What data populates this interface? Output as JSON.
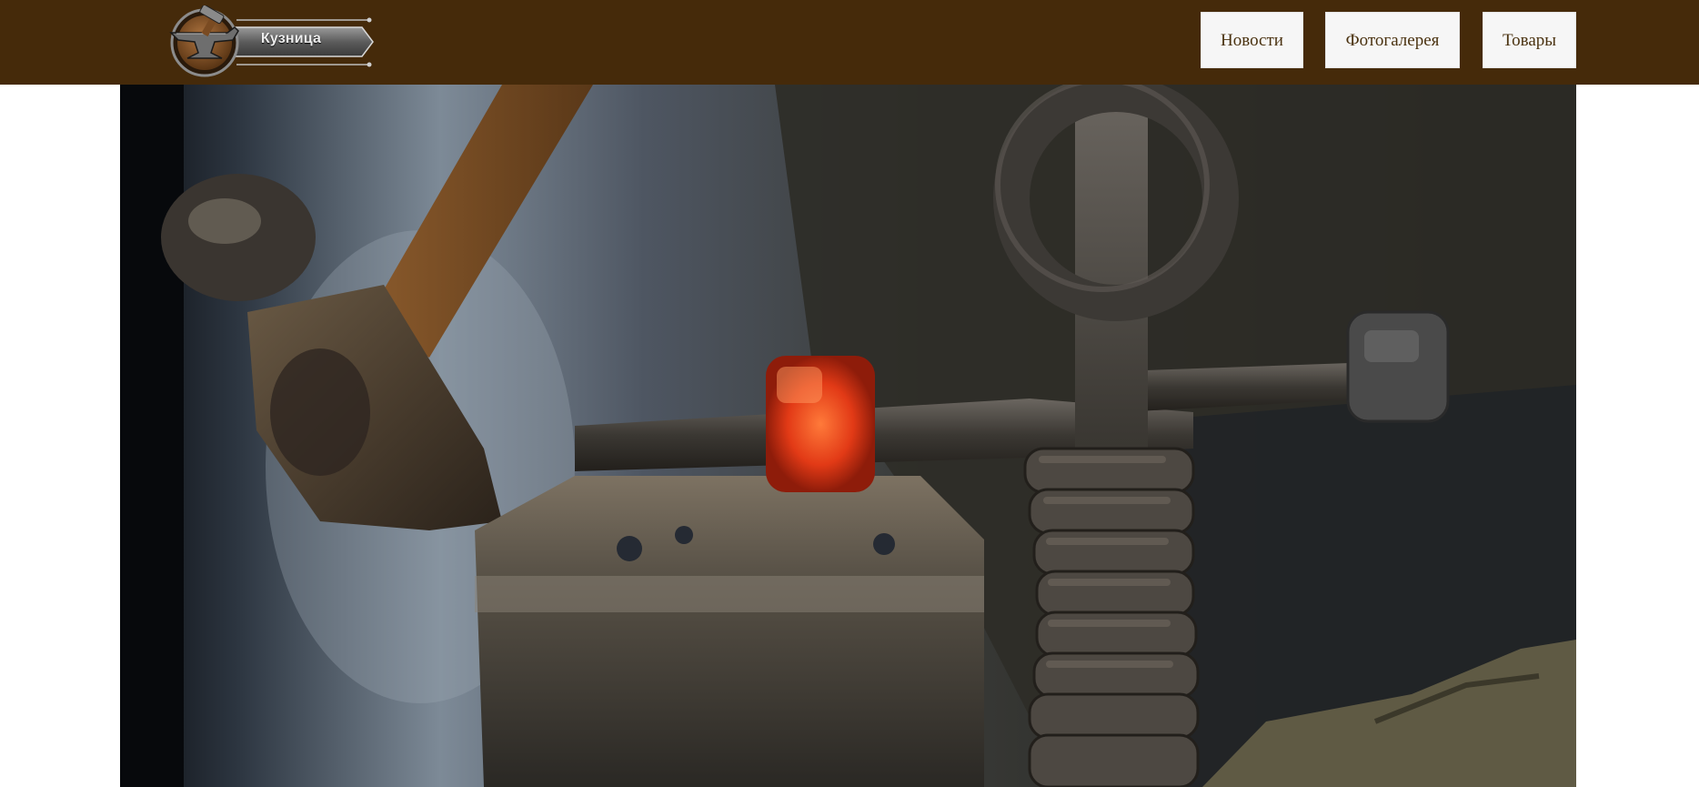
{
  "header": {
    "logo_text": "Кузница",
    "nav": [
      {
        "label": "Новости"
      },
      {
        "label": "Фотогалерея"
      },
      {
        "label": "Товары"
      }
    ]
  },
  "colors": {
    "header_bg": "#452a0a",
    "nav_bg": "#f6f6f6",
    "nav_text": "#4a3210",
    "hot_metal": "#e23a16"
  },
  "hero": {
    "image": "forging-photo"
  }
}
